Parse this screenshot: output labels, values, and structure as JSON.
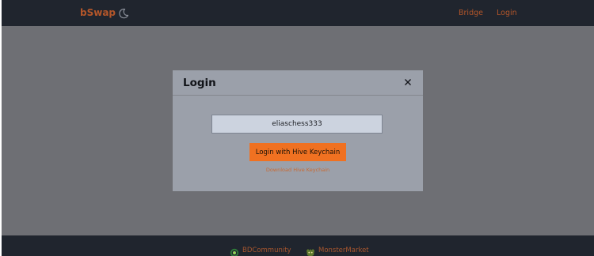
{
  "header": {
    "brand": "bSwap",
    "theme_icon": "moon-icon",
    "nav": {
      "bridge": "Bridge",
      "login": "Login"
    }
  },
  "modal": {
    "title": "Login",
    "close_icon": "close-icon",
    "username_value": "eliaschess333",
    "keychain_button": "Login with Hive Keychain",
    "download_link": "Download Hive Keychain"
  },
  "footer": {
    "links": [
      {
        "label": "BDCommunity",
        "icon": "bdcommunity-icon"
      },
      {
        "label": "MonsterMarket",
        "icon": "monstermarket-icon"
      }
    ]
  },
  "colors": {
    "header_bg": "#20252e",
    "brand_accent": "#b3562a",
    "backdrop": "#6e6f74",
    "modal_bg": "#9ba0aa",
    "input_bg": "#ccd3df",
    "button_orange": "#f07121"
  }
}
